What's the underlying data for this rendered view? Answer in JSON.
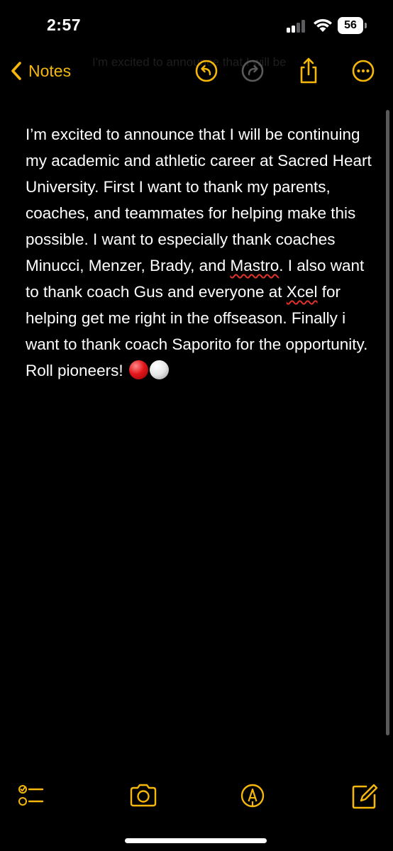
{
  "status_bar": {
    "time": "2:57",
    "battery_level": "56",
    "signal_bars_active": 2,
    "signal_bars_total": 4
  },
  "nav": {
    "back_label": "Notes",
    "ghost_title": "I'm excited to announce that I will be",
    "accent_color": "#f5b70a",
    "icons": [
      "undo-icon",
      "redo-icon",
      "share-icon",
      "more-icon"
    ]
  },
  "note": {
    "segments": {
      "p1": "I’m excited to announce that I will be continuing my academic and athletic career at Sacred Heart University. First I want to thank my parents, coaches, and teammates for helping make this possible. I want to especially thank coaches Minucci, Menzer, Brady, and ",
      "w1": "Mastro",
      "p2": ". I also want to thank coach Gus and everyone at ",
      "w2": "Xcel",
      "p3": " for helping get me right in the offseason. Finally i want to thank coach Saporito for the opportunity. Roll pioneers! "
    },
    "emoji": [
      "red-circle-emoji",
      "white-circle-emoji"
    ]
  },
  "toolbar": {
    "icons": [
      "checklist-icon",
      "camera-icon",
      "markup-icon",
      "compose-icon"
    ]
  }
}
